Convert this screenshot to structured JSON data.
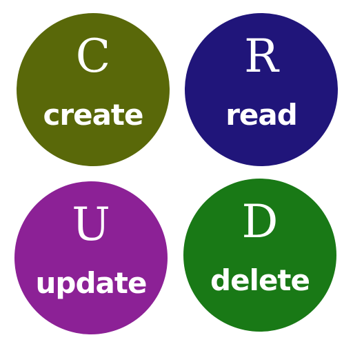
{
  "items": [
    {
      "letter": "C",
      "word": "create",
      "color": "#596809"
    },
    {
      "letter": "R",
      "word": "read",
      "color": "#20157a"
    },
    {
      "letter": "U",
      "word": "update",
      "color": "#8c2196"
    },
    {
      "letter": "D",
      "word": "delete",
      "color": "#197916"
    }
  ]
}
